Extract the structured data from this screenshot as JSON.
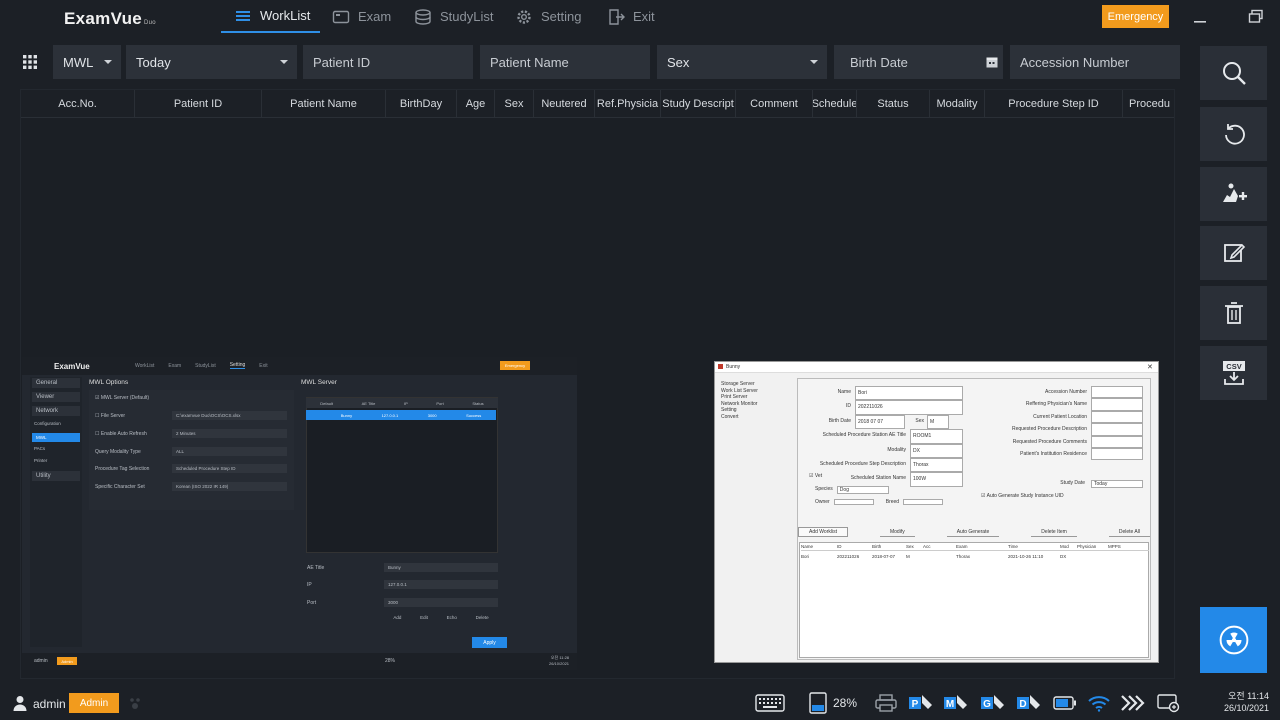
{
  "app": {
    "logo": "ExamVue",
    "logo_suffix": "Duo"
  },
  "nav": {
    "tabs": [
      {
        "label": "WorkList",
        "icon": "list-icon",
        "active": true
      },
      {
        "label": "Exam",
        "icon": "exam-icon",
        "active": false
      },
      {
        "label": "StudyList",
        "icon": "database-icon",
        "active": false
      },
      {
        "label": "Setting",
        "icon": "gear-icon",
        "active": false
      },
      {
        "label": "Exit",
        "icon": "exit-icon",
        "active": false
      }
    ],
    "emergency_label": "Emergency"
  },
  "filters": {
    "source": "MWL",
    "date": "Today",
    "patient_id_placeholder": "Patient ID",
    "patient_name_placeholder": "Patient Name",
    "sex": "Sex",
    "birth_date_placeholder": "Birth Date",
    "accession_placeholder": "Accession Number"
  },
  "table": {
    "columns": [
      "Acc.No.",
      "Patient ID",
      "Patient Name",
      "BirthDay",
      "Age",
      "Sex",
      "Neutered",
      "Ref.Physicia",
      "Study Descript",
      "Comment",
      "Schedule",
      "Status",
      "Modality",
      "Procedure Step ID",
      "Procedu"
    ]
  },
  "right_toolbar": {
    "buttons": [
      "search-icon",
      "refresh-icon",
      "add-patient-icon",
      "edit-icon",
      "delete-icon",
      "csv-export-icon"
    ],
    "csv_label": "CSV",
    "action_icon": "radiation-icon"
  },
  "thumbnail_left": {
    "logo": "ExamVue",
    "tabs": [
      "WorkList",
      "Exam",
      "StudyList",
      "Setting",
      "Exit"
    ],
    "emergency_label": "Emergency",
    "sidebar": [
      "General",
      "Viewer",
      "Network",
      "Configuration",
      "MWL",
      "PACs",
      "Printer",
      "Utility"
    ],
    "options_title": "MWL Options",
    "options": [
      {
        "label": "MWL Server (Default)",
        "value": ""
      },
      {
        "label": "File Server",
        "value": "C:\\examvue Duo\\OCS\\OCS.xlsx"
      },
      {
        "label": "Enable Auto Refresh",
        "value": "2 Minutes"
      },
      {
        "label": "Query Modality Type",
        "value": "ALL"
      },
      {
        "label": "Procedure Tag Selection",
        "value": "Scheduled Procedure Step ID"
      },
      {
        "label": "Specific Character Set",
        "value": "Korean (ISO 2022 IR 149)"
      }
    ],
    "server_title": "MWL Server",
    "server_columns": [
      "Default",
      "AE Title",
      "IP",
      "Port",
      "Status"
    ],
    "server_row": [
      "Bunny",
      "127.0.0.1",
      "3000",
      "Success"
    ],
    "fields": [
      {
        "label": "AE Title",
        "value": "Bunny"
      },
      {
        "label": "IP",
        "value": "127.0.0.1"
      },
      {
        "label": "Port",
        "value": "3000"
      }
    ],
    "buttons": [
      "Add",
      "Edit",
      "Echo",
      "Delete"
    ],
    "apply_label": "Apply",
    "user": "admin",
    "role": "Admin",
    "zoom": "28%",
    "time": "오전 11:28",
    "date": "26/10/2021"
  },
  "thumbnail_right": {
    "title": "Bunny",
    "menu": [
      "Storage Server",
      "Work List Server",
      "Print Server",
      "Network Monitor",
      "Setting",
      "Convert"
    ],
    "form_left": [
      {
        "label": "Name",
        "value": "Bori"
      },
      {
        "label": "ID",
        "value": "202211026"
      },
      {
        "label": "Birth Date",
        "value": "2018  07  07"
      },
      {
        "label": "Scheduled Procedure Station AE Title",
        "value": "ROOM1"
      },
      {
        "label": "Modality",
        "value": "DX"
      },
      {
        "label": "Scheduled Procedure Step Description",
        "value": "Thorax"
      },
      {
        "label": "Scheduled Station Name",
        "value": "100W"
      }
    ],
    "sex_label": "Sex",
    "sex_value": "M",
    "vet_label": "Vet",
    "species_label": "Species",
    "species_value": "Dog",
    "owner_label": "Owner",
    "breed_label": "Breed",
    "form_right": [
      "Accession Number",
      "Reffering Physician's Name",
      "Current Patient Location",
      "Requested Procedure Description",
      "Requested Procedure Comments",
      "Patient's Institution Residence"
    ],
    "study_date_label": "Study Date",
    "study_date_value": "Today",
    "auto_uid_label": "Auto Generate Study Instance UID",
    "buttons": [
      "Add Worklist",
      "Modify",
      "Auto Generate",
      "Delete Item",
      "Delete All"
    ],
    "list_columns": [
      "Name",
      "ID",
      "Birth",
      "Sex",
      "Acc",
      "Exam",
      "Time",
      "Mod",
      "Physician",
      "MPPS"
    ],
    "list_row": [
      "Bori",
      "202211026",
      "2018-07-07",
      "M",
      "",
      "Thorax",
      "2021-10-26 11:10",
      "DX",
      "",
      ""
    ]
  },
  "status": {
    "user": "admin",
    "role": "Admin",
    "zoom": "28%",
    "time": "오전 11:14",
    "date": "26/10/2021"
  }
}
